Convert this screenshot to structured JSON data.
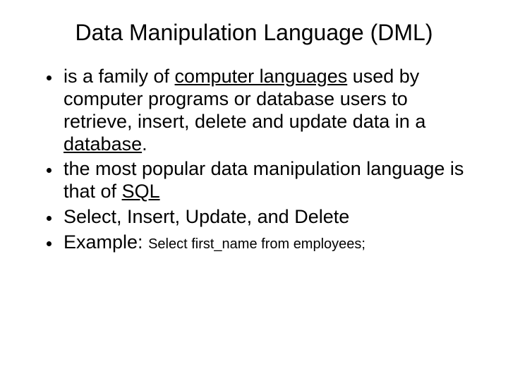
{
  "title": "Data Manipulation Language (DML)",
  "bullets": {
    "b1": {
      "t1": "is a family of ",
      "link1": "computer languages",
      "t2": " used by computer programs or database users to retrieve, insert, delete and update data in a ",
      "link2": "database",
      "t3": "."
    },
    "b2": {
      "t1": "the most popular data manipulation language is that of ",
      "link1": "SQL"
    },
    "b3": {
      "t1": "Select, Insert, Update, and Delete"
    },
    "b4": {
      "t1": "Example: ",
      "code": "Select first_name from employees;"
    }
  }
}
